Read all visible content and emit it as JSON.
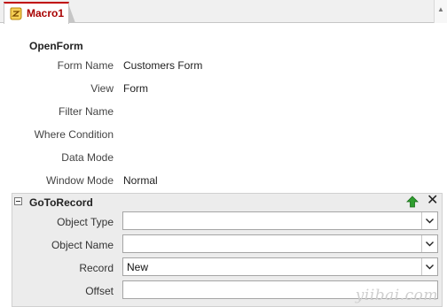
{
  "tab": {
    "title": "Macro1",
    "icon": "macro-icon"
  },
  "openform": {
    "action": "OpenForm",
    "args": [
      {
        "label": "Form Name",
        "value": "Customers Form"
      },
      {
        "label": "View",
        "value": "Form"
      },
      {
        "label": "Filter Name",
        "value": ""
      },
      {
        "label": "Where Condition",
        "value": ""
      },
      {
        "label": "Data Mode",
        "value": ""
      },
      {
        "label": "Window Mode",
        "value": "Normal"
      }
    ]
  },
  "gotorecord": {
    "action": "GoToRecord",
    "fields": [
      {
        "label": "Object Type",
        "value": ""
      },
      {
        "label": "Object Name",
        "value": ""
      },
      {
        "label": "Record",
        "value": "New"
      },
      {
        "label": "Offset",
        "value": ""
      }
    ]
  },
  "watermark": "yiibai.com",
  "colors": {
    "accent": "#c00000",
    "move_up": "#2e9e2e"
  }
}
